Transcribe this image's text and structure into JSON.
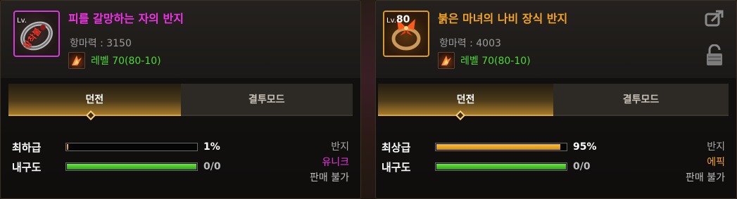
{
  "items": [
    {
      "title": "피를 갈망하는 자의 반지",
      "level_badge_label": "Lv.",
      "level_badge_value": "",
      "grade_stamp": "장착불",
      "power": "항마력 : 3150",
      "requirement": "레벨 70(80-10)",
      "tabs": [
        "던전",
        "결투모드"
      ],
      "active_tab": "던전",
      "stats": [
        {
          "label": "최하급",
          "value": "1%",
          "fill_percent": 1,
          "bar": "gold"
        },
        {
          "label": "내구도",
          "value": "0/0",
          "fill_percent": 100,
          "bar": "green"
        }
      ],
      "type": "반지",
      "rarity": "유니크",
      "sellable": "판매 불가",
      "colors": {
        "frame": "#d23bd6",
        "title": "#ef33e6"
      }
    },
    {
      "title": "붉은 마녀의 나비 장식 반지",
      "level_badge_label": "Lv.",
      "level_badge_value": "80",
      "power": "항마력 : 4003",
      "requirement": "레벨 70(80-10)",
      "tabs": [
        "던전",
        "결투모드"
      ],
      "active_tab": "던전",
      "stats": [
        {
          "label": "최상급",
          "value": "95%",
          "fill_percent": 95,
          "bar": "gold"
        },
        {
          "label": "내구도",
          "value": "0/0",
          "fill_percent": 100,
          "bar": "green"
        }
      ],
      "type": "반지",
      "rarity": "에픽",
      "sellable": "판매 불가",
      "actions": [
        "share-icon",
        "lock-icon"
      ],
      "colors": {
        "frame": "#d99a2b",
        "title": "#f2a224"
      }
    }
  ]
}
